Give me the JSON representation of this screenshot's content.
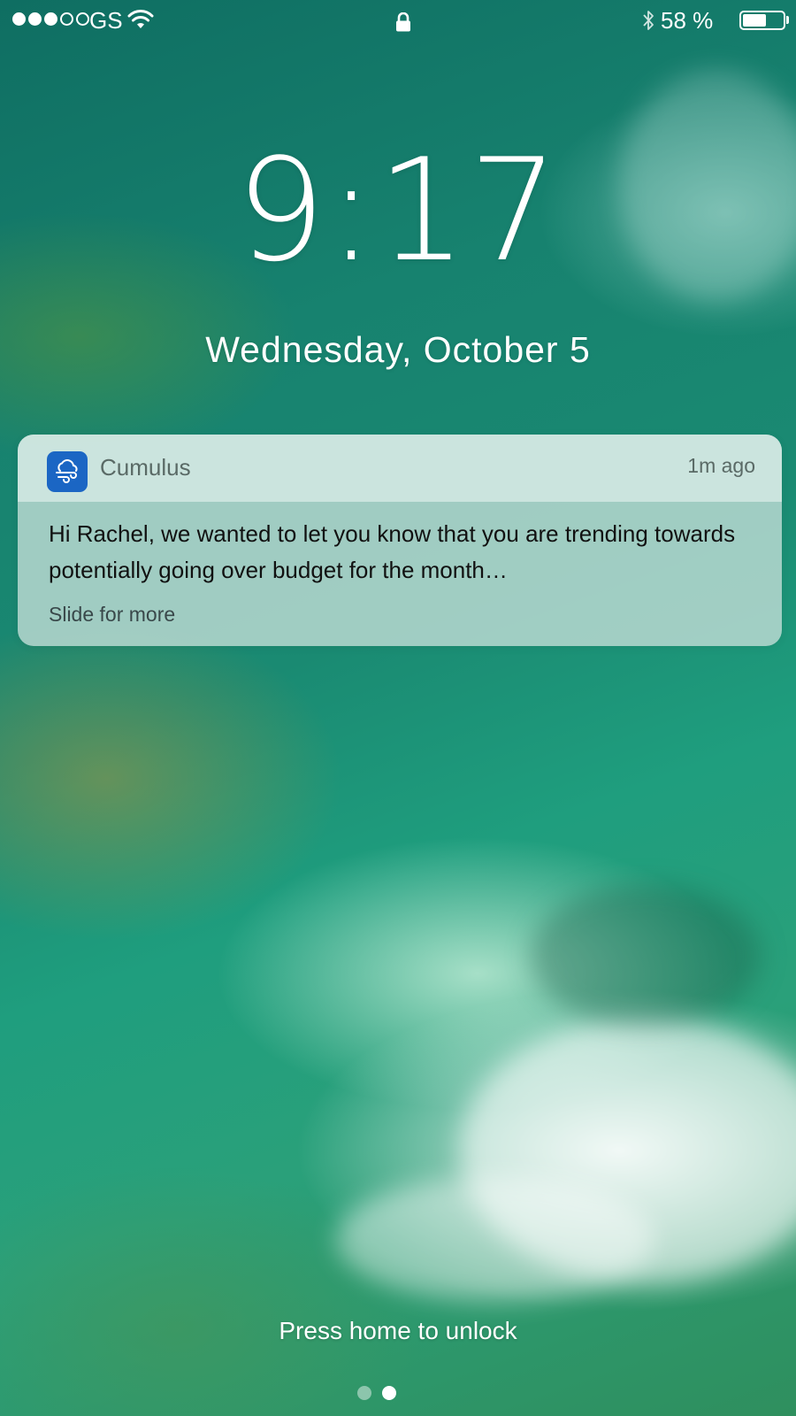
{
  "status_bar": {
    "signal_filled": 3,
    "signal_total": 5,
    "carrier": "GS",
    "battery_text": "58 %",
    "battery_level": 0.58
  },
  "lock_screen": {
    "time": "9:17",
    "date": "Wednesday, October 5",
    "unlock_hint": "Press home to unlock",
    "pages": 2,
    "active_page": 1
  },
  "notification": {
    "app_name": "Cumulus",
    "app_icon": "wind-cloud-icon",
    "app_icon_color": "#1b66c4",
    "time_ago": "1m ago",
    "message": "Hi Rachel, we wanted to let you know that you are trending towards potentially going over budget for the month…",
    "action_hint": "Slide for more"
  },
  "colors": {
    "wallpaper_primary": "#17826f",
    "text": "#ffffff"
  }
}
